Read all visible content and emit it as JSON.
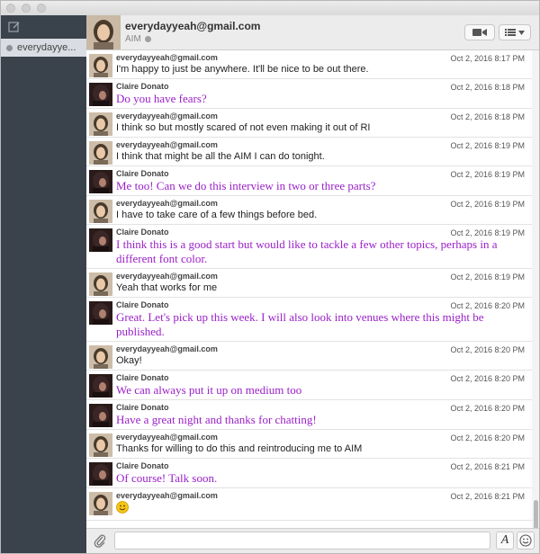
{
  "window": {
    "title": ""
  },
  "sidebar": {
    "compose_icon": "compose-icon",
    "items": [
      {
        "label": "everydayye...",
        "status_color": "#8d9199"
      }
    ]
  },
  "header": {
    "contact_name": "everydayyeah@gmail.com",
    "service": "AIM",
    "video_icon": "video-camera-icon",
    "menu_icon": "list-menu-icon"
  },
  "colors": {
    "claire_text": "#9a20c8",
    "self_text": "#222222",
    "sidebar_bg": "#3a424c"
  },
  "messages": [
    {
      "sender": "everydayyeah@gmail.com",
      "time": "Oct 2, 2016 8:17 PM",
      "text": "I'm happy to just be anywhere. It'll be nice to be out there."
    },
    {
      "sender": "Claire Donato",
      "time": "Oct 2, 2016 8:18 PM",
      "text": "Do you have fears?"
    },
    {
      "sender": "everydayyeah@gmail.com",
      "time": "Oct 2, 2016 8:18 PM",
      "text": "I think so but mostly scared of not even making it out of RI"
    },
    {
      "sender": "everydayyeah@gmail.com",
      "time": "Oct 2, 2016 8:19 PM",
      "text": "I think that might be all the AIM I can do tonight."
    },
    {
      "sender": "Claire Donato",
      "time": "Oct 2, 2016 8:19 PM",
      "text": "Me too! Can we do this interview in two or three parts?"
    },
    {
      "sender": "everydayyeah@gmail.com",
      "time": "Oct 2, 2016 8:19 PM",
      "text": "I have to take care of a few things before bed."
    },
    {
      "sender": "Claire Donato",
      "time": "Oct 2, 2016 8:19 PM",
      "text": "I think this is a good start but would like to tackle a few other topics, perhaps in a different font color."
    },
    {
      "sender": "everydayyeah@gmail.com",
      "time": "Oct 2, 2016 8:19 PM",
      "text": "Yeah that works for me"
    },
    {
      "sender": "Claire Donato",
      "time": "Oct 2, 2016 8:20 PM",
      "text": "Great. Let's pick up this week. I will also look into venues where this might be published."
    },
    {
      "sender": "everydayyeah@gmail.com",
      "time": "Oct 2, 2016 8:20 PM",
      "text": "Okay!"
    },
    {
      "sender": "Claire Donato",
      "time": "Oct 2, 2016 8:20 PM",
      "text": "We can always put it up on medium too"
    },
    {
      "sender": "Claire Donato",
      "time": "Oct 2, 2016 8:20 PM",
      "text": "Have a great night and thanks for chatting!"
    },
    {
      "sender": "everydayyeah@gmail.com",
      "time": "Oct 2, 2016 8:20 PM",
      "text": "Thanks for willing to do this and reintroducing me to AIM"
    },
    {
      "sender": "Claire Donato",
      "time": "Oct 2, 2016 8:21 PM",
      "text": "Of course! Talk soon."
    },
    {
      "sender": "everydayyeah@gmail.com",
      "time": "Oct 2, 2016 8:21 PM",
      "text": "",
      "emoji": "smiley-emoji-icon"
    }
  ],
  "input": {
    "value": "",
    "placeholder": "",
    "attach_icon": "paperclip-icon",
    "font_label": "A",
    "emoji_icon": "smiley-icon"
  }
}
